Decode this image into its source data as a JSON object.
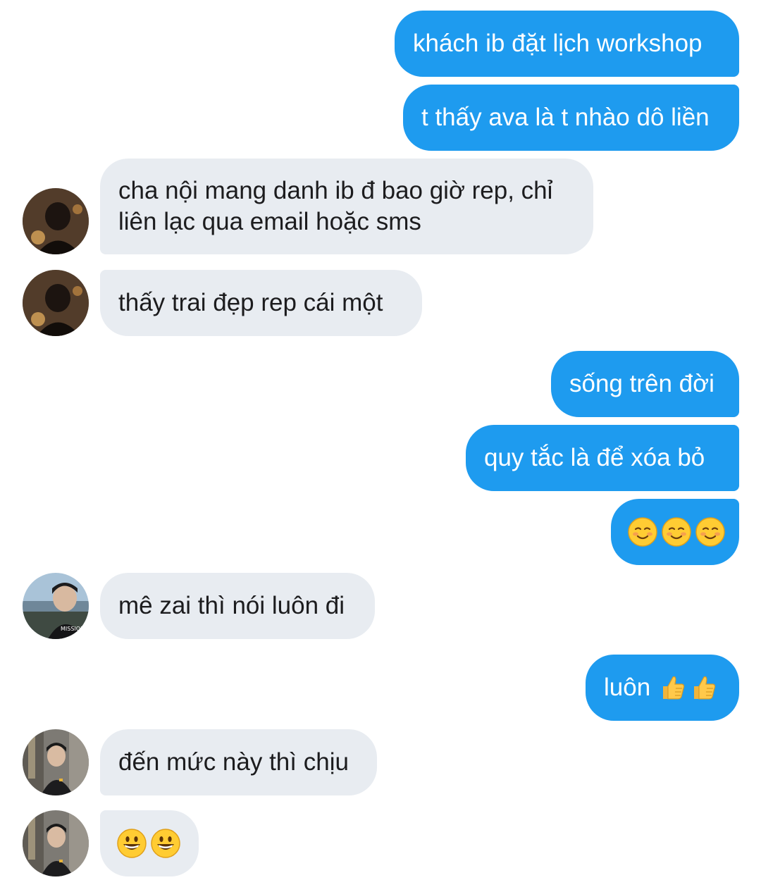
{
  "messages": [
    {
      "from": "me",
      "text": "khách ib đặt lịch workshop"
    },
    {
      "from": "me",
      "text": "t thấy ava là t nhào dô liền"
    },
    {
      "from": "other1",
      "text": "cha nội mang danh ib đ bao giờ rep, chỉ liên lạc qua email hoặc sms"
    },
    {
      "from": "other1",
      "text": "thấy trai đẹp rep cái một"
    },
    {
      "from": "me",
      "text": "sống trên đời"
    },
    {
      "from": "me",
      "text": "quy tắc là để xóa bỏ"
    },
    {
      "from": "me",
      "text": "☺☺☺",
      "icons": [
        "smiling-face-icon",
        "smiling-face-icon",
        "smiling-face-icon"
      ]
    },
    {
      "from": "other2",
      "text": "mê zai thì nói luôn đi"
    },
    {
      "from": "me",
      "text": "luôn",
      "icons": [
        "thumbs-up-icon",
        "thumbs-up-icon"
      ]
    },
    {
      "from": "other3",
      "text": "đến mức này thì chịu"
    },
    {
      "from": "other3",
      "text": "😃😃",
      "icons": [
        "grinning-face-icon",
        "grinning-face-icon"
      ]
    }
  ],
  "colors": {
    "outgoing_bubble": "#1e9bef",
    "incoming_bubble": "#e8ecf1",
    "outgoing_text": "#ffffff",
    "incoming_text": "#1c1c1e"
  }
}
